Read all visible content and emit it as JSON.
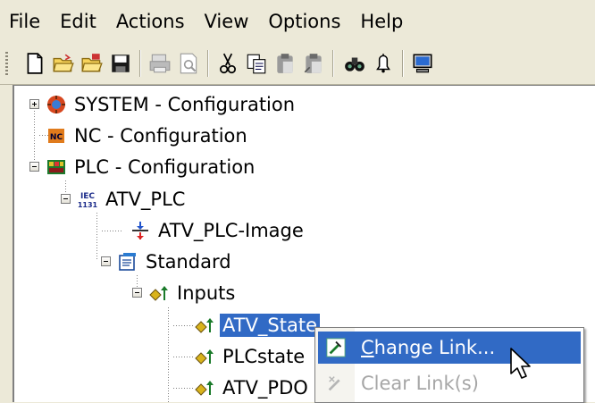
{
  "menubar": {
    "items": [
      "File",
      "Edit",
      "Actions",
      "View",
      "Options",
      "Help"
    ]
  },
  "toolbar": {
    "buttons": [
      {
        "icon": "new-document-icon"
      },
      {
        "icon": "open-folder-icon"
      },
      {
        "icon": "open-folder-alt-icon"
      },
      {
        "icon": "save-icon"
      },
      {
        "icon": "print-icon"
      },
      {
        "icon": "print-preview-icon"
      },
      {
        "icon": "cut-icon"
      },
      {
        "icon": "copy-icon"
      },
      {
        "icon": "paste-icon"
      },
      {
        "icon": "paste-alt-icon"
      },
      {
        "icon": "find-icon"
      },
      {
        "icon": "bell-icon"
      },
      {
        "icon": "monitor-icon"
      }
    ]
  },
  "tree": {
    "nodes": [
      {
        "label": "SYSTEM - Configuration",
        "icon": "system-config-icon",
        "expander": "plus"
      },
      {
        "label": "NC - Configuration",
        "icon": "nc-config-icon"
      },
      {
        "label": "PLC - Configuration",
        "icon": "plc-config-icon",
        "expander": "minus"
      },
      {
        "label": "ATV_PLC",
        "icon": "iec-1131-icon",
        "expander": "minus"
      },
      {
        "label": "ATV_PLC-Image",
        "icon": "plc-image-icon"
      },
      {
        "label": "Standard",
        "icon": "standard-task-icon",
        "expander": "minus"
      },
      {
        "label": "Inputs",
        "icon": "inputs-folder-icon",
        "expander": "minus"
      },
      {
        "label": "ATV_State",
        "icon": "input-variable-icon",
        "selected": true
      },
      {
        "label": "PLCstate",
        "icon": "input-variable-icon"
      },
      {
        "label": "ATV_PDO",
        "icon": "input-variable-icon"
      }
    ],
    "selection_color": "#316ac5"
  },
  "context_menu": {
    "items": [
      {
        "label": "Change Link...",
        "icon": "change-link-icon",
        "highlighted": true,
        "disabled": false
      },
      {
        "label": "Clear Link(s)",
        "icon": "clear-link-icon",
        "highlighted": false,
        "disabled": true
      }
    ]
  }
}
